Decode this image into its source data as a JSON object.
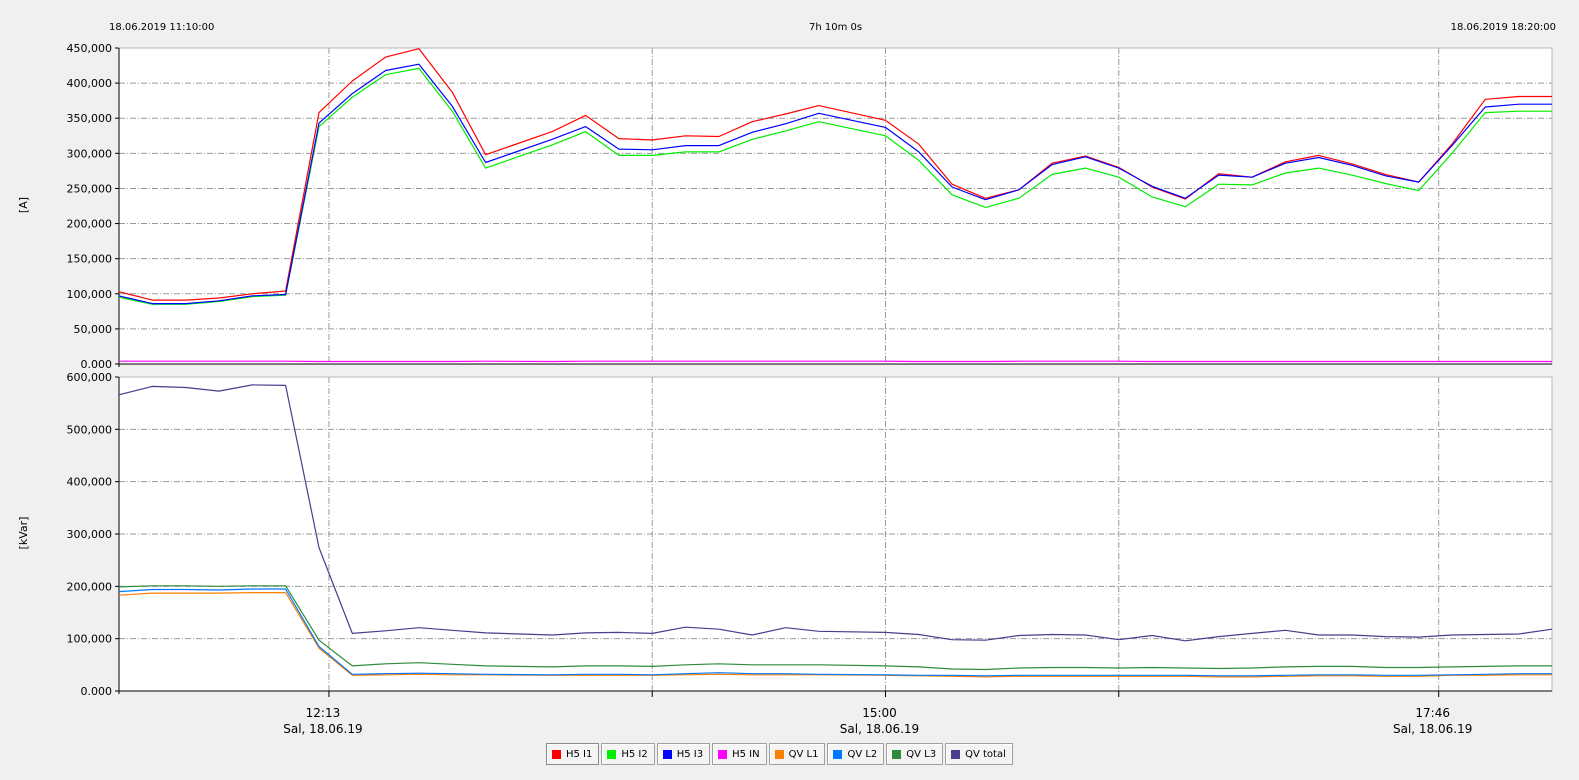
{
  "header": {
    "start": "18.06.2019 11:10:00",
    "span": "7h 10m 0s",
    "end": "18.06.2019 18:20:00"
  },
  "chart_data": [
    {
      "type": "line",
      "ylabel": "[A]",
      "ylim": [
        0,
        450000
      ],
      "yticks": [
        "0.000",
        "50,000",
        "100,000",
        "150,000",
        "200,000",
        "250,000",
        "300,000",
        "350,000",
        "400,000",
        "450,000"
      ],
      "x_time": [
        "11:10",
        "11:20",
        "11:30",
        "11:40",
        "11:50",
        "12:00",
        "12:10",
        "12:20",
        "12:30",
        "12:40",
        "12:50",
        "13:00",
        "13:20",
        "13:30",
        "13:40",
        "13:50",
        "14:00",
        "14:10",
        "14:20",
        "14:30",
        "14:40",
        "15:00",
        "15:10",
        "15:20",
        "15:30",
        "15:40",
        "15:50",
        "16:00",
        "16:10",
        "16:20",
        "16:30",
        "16:40",
        "16:50",
        "17:00",
        "17:10",
        "17:20",
        "17:30",
        "17:40",
        "17:50",
        "18:00",
        "18:10",
        "18:20"
      ],
      "series": [
        {
          "name": "H5 I1",
          "color": "#ff0000",
          "values": [
            103000,
            91000,
            91000,
            94000,
            100000,
            104000,
            358000,
            403000,
            437000,
            449000,
            387000,
            298000,
            331000,
            354000,
            321000,
            319000,
            325000,
            324000,
            345000,
            356000,
            368000,
            347000,
            313000,
            256000,
            236000,
            248000,
            286000,
            296000,
            280000,
            252000,
            235000,
            271000,
            266000,
            288000,
            297000,
            285000,
            270000,
            259000,
            313000,
            377000,
            381000,
            381000
          ]
        },
        {
          "name": "H5 I2",
          "color": "#00ee00",
          "values": [
            95000,
            85000,
            85000,
            89000,
            96000,
            98000,
            338000,
            380000,
            412000,
            421000,
            360000,
            279000,
            312000,
            331000,
            297000,
            297000,
            302000,
            302000,
            320000,
            332000,
            345000,
            325000,
            290000,
            241000,
            223000,
            236000,
            270000,
            279000,
            266000,
            238000,
            224000,
            256000,
            255000,
            272000,
            279000,
            269000,
            257000,
            247000,
            300000,
            358000,
            360000,
            360000
          ]
        },
        {
          "name": "H5 I3",
          "color": "#0000ff",
          "values": [
            97000,
            86000,
            86000,
            90000,
            97000,
            99000,
            343000,
            385000,
            418000,
            427000,
            367000,
            287000,
            320000,
            338000,
            306000,
            305000,
            311000,
            311000,
            330000,
            342000,
            357000,
            337000,
            302000,
            252000,
            234000,
            248000,
            284000,
            295000,
            279000,
            253000,
            236000,
            269000,
            266000,
            286000,
            294000,
            283000,
            268000,
            259000,
            311000,
            366000,
            370000,
            370000
          ]
        },
        {
          "name": "H5 IN",
          "color": "#ff00ff",
          "values": [
            4000,
            4000,
            4000,
            4000,
            4000,
            4000,
            3500,
            3500,
            3500,
            3500,
            3500,
            4000,
            3500,
            4000,
            4000,
            4000,
            4000,
            4000,
            4000,
            4000,
            4000,
            4000,
            3500,
            3500,
            3500,
            4000,
            4000,
            4000,
            4000,
            3500,
            3500,
            3500,
            3500,
            3500,
            3500,
            3500,
            3500,
            3500,
            3500,
            3500,
            3500,
            3500
          ]
        }
      ]
    },
    {
      "type": "line",
      "ylabel": "[kVar]",
      "ylim": [
        0,
        600000
      ],
      "yticks": [
        "0.000",
        "100,000",
        "200,000",
        "300,000",
        "400,000",
        "500,000",
        "600,000"
      ],
      "x_time": [
        "11:10",
        "11:20",
        "11:30",
        "11:40",
        "11:50",
        "12:00",
        "12:10",
        "12:20",
        "12:30",
        "12:40",
        "12:50",
        "13:00",
        "13:20",
        "13:30",
        "13:40",
        "13:50",
        "14:00",
        "14:10",
        "14:20",
        "14:30",
        "14:40",
        "15:00",
        "15:10",
        "15:20",
        "15:30",
        "15:40",
        "15:50",
        "16:00",
        "16:10",
        "16:20",
        "16:30",
        "16:40",
        "16:50",
        "17:00",
        "17:10",
        "17:20",
        "17:30",
        "17:40",
        "17:50",
        "18:00",
        "18:10",
        "18:20"
      ],
      "series": [
        {
          "name": "QV L1",
          "color": "#ff8000",
          "values": [
            183000,
            187000,
            187000,
            187000,
            188000,
            188000,
            82000,
            30000,
            31000,
            32000,
            31000,
            31000,
            30000,
            30000,
            30000,
            30000,
            31000,
            32000,
            31000,
            31000,
            31000,
            30000,
            29000,
            28000,
            27000,
            28000,
            28000,
            28000,
            28000,
            28000,
            28000,
            27000,
            27000,
            28000,
            29000,
            29000,
            28000,
            28000,
            30000,
            30000,
            31000,
            31000
          ]
        },
        {
          "name": "QV L2",
          "color": "#0078ff",
          "values": [
            190000,
            194000,
            194000,
            193000,
            195000,
            195000,
            85000,
            32000,
            33000,
            34000,
            33000,
            32000,
            31000,
            32000,
            32000,
            31000,
            33000,
            35000,
            33000,
            33000,
            32000,
            31000,
            30000,
            30000,
            29000,
            30000,
            30000,
            30000,
            30000,
            30000,
            30000,
            29000,
            29000,
            30000,
            31000,
            31000,
            30000,
            30000,
            31000,
            32000,
            33000,
            33000
          ]
        },
        {
          "name": "QV L3",
          "color": "#2e8b3d",
          "values": [
            199000,
            201000,
            201000,
            200000,
            201000,
            201000,
            97000,
            48000,
            52000,
            54000,
            51000,
            48000,
            46000,
            48000,
            48000,
            47000,
            50000,
            52000,
            50000,
            50000,
            50000,
            48000,
            46000,
            42000,
            41000,
            44000,
            45000,
            45000,
            44000,
            45000,
            44000,
            43000,
            44000,
            46000,
            47000,
            47000,
            45000,
            45000,
            46000,
            47000,
            48000,
            48000
          ]
        },
        {
          "name": "QV total",
          "color": "#4b3c8c",
          "values": [
            566000,
            582000,
            580000,
            573000,
            585000,
            584000,
            274000,
            110000,
            115000,
            121000,
            116000,
            111000,
            107000,
            111000,
            112000,
            110000,
            122000,
            118000,
            107000,
            121000,
            114000,
            112000,
            108000,
            98000,
            97000,
            106000,
            108000,
            107000,
            98000,
            106000,
            96000,
            104000,
            110000,
            116000,
            107000,
            107000,
            104000,
            103000,
            107000,
            108000,
            109000,
            118000
          ]
        }
      ]
    }
  ],
  "x_axis": {
    "ticks": [
      {
        "time": "12:13",
        "label": "12:13",
        "sublabel": "Sal, 18.06.19"
      },
      {
        "time": "13:50",
        "label": "",
        "sublabel": ""
      },
      {
        "time": "15:00",
        "label": "15:00",
        "sublabel": "Sal, 18.06.19"
      },
      {
        "time": "16:10",
        "label": "",
        "sublabel": ""
      },
      {
        "time": "17:46",
        "label": "17:46",
        "sublabel": "Sal, 18.06.19"
      }
    ],
    "start": "11:10",
    "end": "18:20"
  },
  "legend": [
    {
      "label": "H5 I1",
      "color": "#ff0000"
    },
    {
      "label": "H5 I2",
      "color": "#00ee00"
    },
    {
      "label": "H5 I3",
      "color": "#0000ff"
    },
    {
      "label": "H5 IN",
      "color": "#ff00ff"
    },
    {
      "label": "QV L1",
      "color": "#ff8000"
    },
    {
      "label": "QV L2",
      "color": "#0078ff"
    },
    {
      "label": "QV L3",
      "color": "#2e8b3d"
    },
    {
      "label": "QV total",
      "color": "#4b3c8c"
    }
  ]
}
